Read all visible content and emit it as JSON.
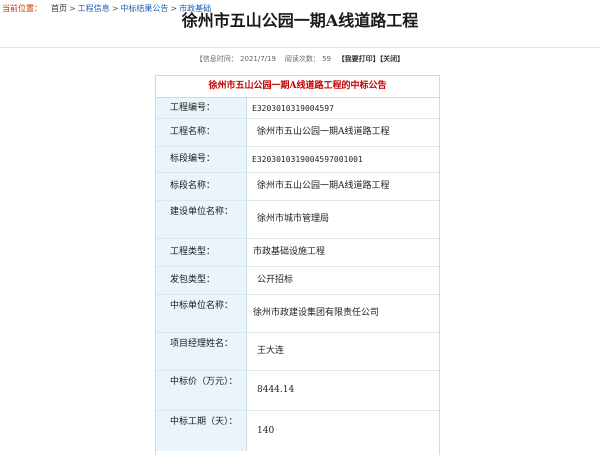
{
  "breadcrumb": {
    "location_label": "当前位置：",
    "items": [
      "首页",
      "工程信息",
      "中标结果公告",
      "市政基础"
    ],
    "separator": ">"
  },
  "page": {
    "title": "徐州市五山公园一期A线道路工程"
  },
  "meta": {
    "info_time_label": "【信息时间：",
    "info_time_value": "2021/7/19",
    "views_label": "阅读次数：",
    "views_value": "59",
    "print_label": "【我要打印】",
    "close_label": "【关闭】"
  },
  "notice": {
    "title": "徐州市五山公园一期A线道路工程的中标公告",
    "rows": [
      {
        "label": "工程编号：",
        "value": "E3203010319004597"
      },
      {
        "label": "工程名称：",
        "value": "徐州市五山公园一期A线道路工程"
      },
      {
        "label": "标段编号：",
        "value": "E3203010319004597001001"
      },
      {
        "label": "标段名称：",
        "value": "徐州市五山公园一期A线道路工程"
      },
      {
        "label": "建设单位名称：",
        "value": "徐州市城市管理局"
      },
      {
        "label": "工程类型：",
        "value": "市政基础设施工程"
      },
      {
        "label": "发包类型：",
        "value": "公开招标"
      },
      {
        "label": "中标单位名称：",
        "value": "徐州市政建设集团有限责任公司"
      },
      {
        "label": "项目经理姓名：",
        "value": "王大连"
      },
      {
        "label": "中标价（万元）：",
        "value": "8444.14"
      },
      {
        "label": "中标工期（天）：",
        "value": "140"
      }
    ]
  }
}
